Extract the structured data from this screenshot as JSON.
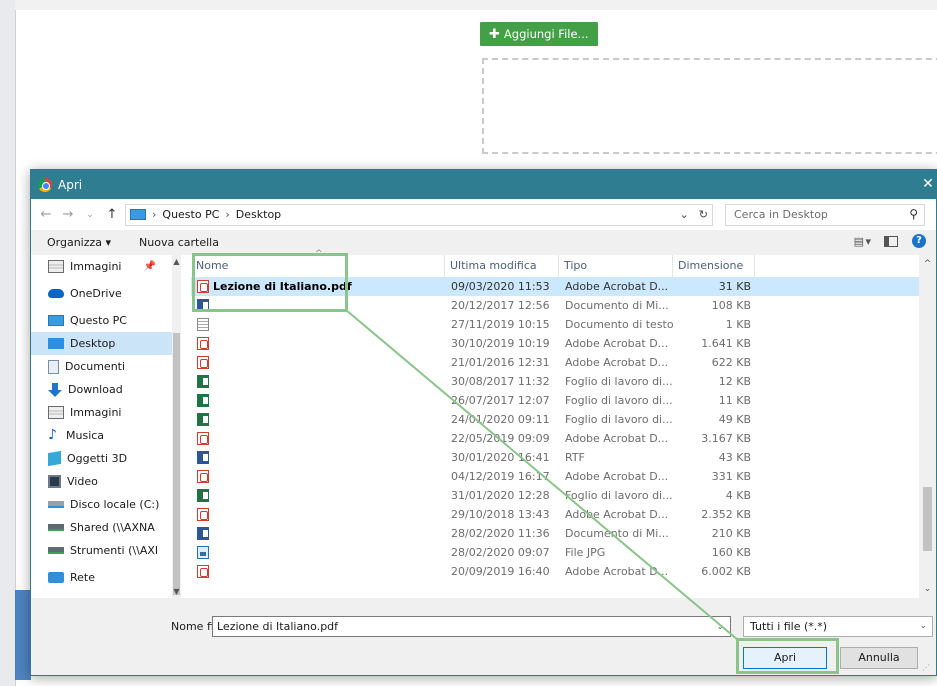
{
  "webpage": {
    "add_file_label": "Aggiungi File..."
  },
  "dialog": {
    "title": "Apri",
    "close_glyph": "✕",
    "nav": {
      "back_glyph": "←",
      "forward_glyph": "→",
      "recent_glyph": "⌄",
      "up_glyph": "↑",
      "breadcrumb": [
        "Questo PC",
        "Desktop"
      ],
      "breadcrumb_sep": "›",
      "refresh_glyph": "↻",
      "dropdown_glyph": "⌄"
    },
    "search_placeholder": "Cerca in Desktop",
    "toolbar": {
      "organize": "Organizza ▾",
      "new_folder": "Nuova cartella",
      "help": "?"
    },
    "sidebar": {
      "items": [
        {
          "label": "Immagini",
          "icon": "images-icon",
          "pinned": true
        },
        {
          "label": "OneDrive",
          "icon": "onedrive-icon"
        },
        {
          "label": "Questo PC",
          "icon": "this-pc-icon"
        },
        {
          "label": "Desktop",
          "icon": "desktop-icon",
          "selected": true
        },
        {
          "label": "Documenti",
          "icon": "documents-icon"
        },
        {
          "label": "Download",
          "icon": "download-icon"
        },
        {
          "label": "Immagini",
          "icon": "images-icon"
        },
        {
          "label": "Musica",
          "icon": "music-icon"
        },
        {
          "label": "Oggetti 3D",
          "icon": "3d-objects-icon"
        },
        {
          "label": "Video",
          "icon": "video-icon"
        },
        {
          "label": "Disco locale (C:)",
          "icon": "local-disk-icon"
        },
        {
          "label": "Shared (\\\\AXNA",
          "icon": "network-drive-icon"
        },
        {
          "label": "Strumenti (\\\\AXI",
          "icon": "network-drive-icon"
        },
        {
          "label": "Rete",
          "icon": "network-icon"
        }
      ]
    },
    "columns": {
      "name": "Nome",
      "modified": "Ultima modifica",
      "type": "Tipo",
      "size": "Dimensione"
    },
    "files": [
      {
        "name": "Lezione di Italiano.pdf",
        "modified": "09/03/2020 11:53",
        "type": "Adobe Acrobat D...",
        "size": "31 KB",
        "icon": "pdf",
        "selected": true
      },
      {
        "name": "",
        "modified": "20/12/2017 12:56",
        "type": "Documento di Mi...",
        "size": "108 KB",
        "icon": "word"
      },
      {
        "name": "",
        "modified": "27/11/2019 10:15",
        "type": "Documento di testo",
        "size": "1 KB",
        "icon": "txt"
      },
      {
        "name": "",
        "modified": "30/10/2019 10:19",
        "type": "Adobe Acrobat D...",
        "size": "1.641 KB",
        "icon": "pdf"
      },
      {
        "name": "",
        "modified": "21/01/2016 12:31",
        "type": "Adobe Acrobat D...",
        "size": "622 KB",
        "icon": "pdf"
      },
      {
        "name": "",
        "modified": "30/08/2017 11:32",
        "type": "Foglio di lavoro di...",
        "size": "12 KB",
        "icon": "excel"
      },
      {
        "name": "",
        "modified": "26/07/2017 12:07",
        "type": "Foglio di lavoro di...",
        "size": "11 KB",
        "icon": "excel"
      },
      {
        "name": "",
        "modified": "24/01/2020 09:11",
        "type": "Foglio di lavoro di...",
        "size": "49 KB",
        "icon": "excel"
      },
      {
        "name": "",
        "modified": "22/05/2019 09:09",
        "type": "Adobe Acrobat D...",
        "size": "3.167 KB",
        "icon": "pdf"
      },
      {
        "name": "",
        "modified": "30/01/2020 16:41",
        "type": "RTF",
        "size": "43 KB",
        "icon": "word"
      },
      {
        "name": "",
        "modified": "04/12/2019 16:17",
        "type": "Adobe Acrobat D...",
        "size": "331 KB",
        "icon": "pdf"
      },
      {
        "name": "",
        "modified": "31/01/2020 12:28",
        "type": "Foglio di lavoro di...",
        "size": "4 KB",
        "icon": "excel"
      },
      {
        "name": "",
        "modified": "29/10/2018 13:43",
        "type": "Adobe Acrobat D...",
        "size": "2.352 KB",
        "icon": "pdf"
      },
      {
        "name": "",
        "modified": "28/02/2020 11:36",
        "type": "Documento di Mi...",
        "size": "210 KB",
        "icon": "word"
      },
      {
        "name": "",
        "modified": "28/02/2020 09:07",
        "type": "File JPG",
        "size": "160 KB",
        "icon": "jpg"
      },
      {
        "name": "",
        "modified": "20/09/2019 16:40",
        "type": "Adobe Acrobat D...",
        "size": "6.002 KB",
        "icon": "pdf"
      }
    ],
    "filename_label": "Nome file:",
    "filename_value": "Lezione di Italiano.pdf",
    "filter_value": "Tutti i file (*.*)",
    "open_label": "Apri",
    "cancel_label": "Annulla"
  },
  "colors": {
    "titlebar": "#2e7d90",
    "add_button": "#43a047",
    "highlight": "#8bc48a",
    "selection": "#cce8ff"
  }
}
